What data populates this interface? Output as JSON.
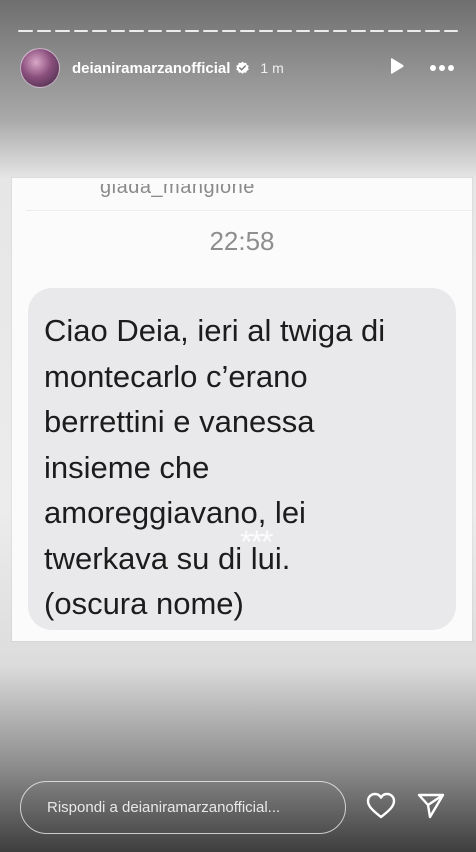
{
  "story": {
    "username": "deianiramarzanofficial",
    "time_ago": "1 m",
    "segment_count": 24
  },
  "screenshot": {
    "cut_sender": "giada_mangione",
    "timestamp": "22:58",
    "message_lines": [
      "Ciao Deia, ieri al twiga di",
      "montecarlo c’erano",
      "berrettini e vanessa",
      "insieme che",
      "amoreggiavano, lei",
      "twerkava su di lui.",
      "(oscura nome)"
    ],
    "scribble": "***"
  },
  "reply": {
    "placeholder": "Rispondi a deianiramarzanofficial..."
  },
  "icons": {
    "verified": "verified-badge-icon",
    "play": "play-icon",
    "more": "more-options-icon",
    "like": "heart-icon",
    "share": "send-icon"
  },
  "colors": {
    "bubble": "#e9e9eb",
    "text": "#1c1c1c",
    "timestamp": "#8e8e8e"
  }
}
